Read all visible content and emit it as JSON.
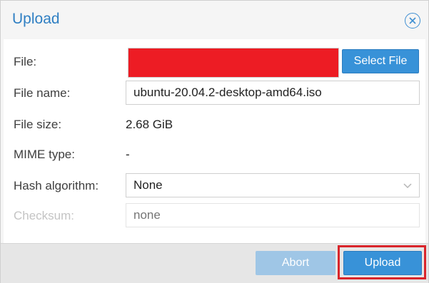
{
  "dialog": {
    "title": "Upload",
    "close_icon": "close-circle-icon"
  },
  "form": {
    "file_label": "File:",
    "select_file_label": "Select File",
    "file_name_label": "File name:",
    "file_name_value": "ubuntu-20.04.2-desktop-amd64.iso",
    "file_size_label": "File size:",
    "file_size_value": "2.68 GiB",
    "mime_type_label": "MIME type:",
    "mime_type_value": "-",
    "hash_label": "Hash algorithm:",
    "hash_value": "None",
    "checksum_label": "Checksum:",
    "checksum_placeholder": "none"
  },
  "footer": {
    "abort_label": "Abort",
    "upload_label": "Upload"
  },
  "colors": {
    "accent": "#3892d8",
    "title": "#2f7fc3",
    "redaction": "#ed1c24",
    "highlight": "#d9252b"
  }
}
